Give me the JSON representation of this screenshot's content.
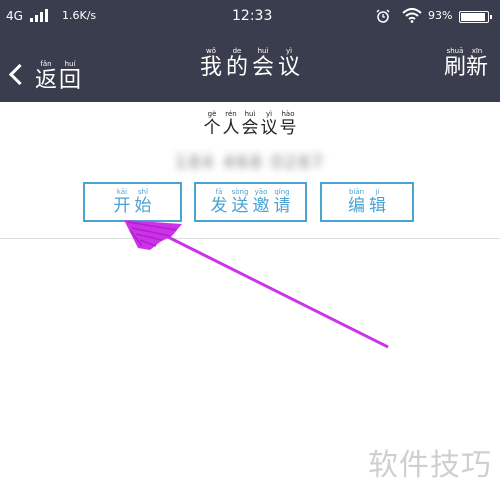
{
  "status_bar": {
    "carrier": "4G",
    "speed": "1.6K/s",
    "time": "12:33",
    "battery_text": "93%",
    "battery_level": 0.93,
    "icons": [
      "signal-icon",
      "alarm-icon",
      "wifi-icon",
      "battery-icon"
    ]
  },
  "header": {
    "back_icon": "chevron-left-icon",
    "back": [
      {
        "py": "fǎn",
        "hz": "返"
      },
      {
        "py": "huí",
        "hz": "回"
      }
    ],
    "title": [
      {
        "py": "wǒ",
        "hz": "我"
      },
      {
        "py": "de",
        "hz": "的"
      },
      {
        "py": "huì",
        "hz": "会"
      },
      {
        "py": "yì",
        "hz": "议"
      }
    ],
    "refresh": [
      {
        "py": "shuā",
        "hz": "刷"
      },
      {
        "py": "xīn",
        "hz": "新"
      }
    ]
  },
  "meeting": {
    "label": [
      {
        "py": "gè",
        "hz": "个"
      },
      {
        "py": "rén",
        "hz": "人"
      },
      {
        "py": "huì",
        "hz": "会"
      },
      {
        "py": "yì",
        "hz": "议"
      },
      {
        "py": "hào",
        "hz": "号"
      }
    ],
    "number": "184 468 0287"
  },
  "buttons": {
    "start": [
      {
        "py": "kāi",
        "hz": "开"
      },
      {
        "py": "shǐ",
        "hz": "始"
      }
    ],
    "invite": [
      {
        "py": "fā",
        "hz": "发"
      },
      {
        "py": "sòng",
        "hz": "送"
      },
      {
        "py": "yāo",
        "hz": "邀"
      },
      {
        "py": "qǐng",
        "hz": "请"
      }
    ],
    "edit": [
      {
        "py": "biān",
        "hz": "编"
      },
      {
        "py": "jí",
        "hz": "辑"
      }
    ]
  },
  "colors": {
    "header_bg": "#3a3d4d",
    "button_accent": "#4aa3d3",
    "annotation_arrow": "#cc33e6"
  },
  "watermark": "软件技巧"
}
